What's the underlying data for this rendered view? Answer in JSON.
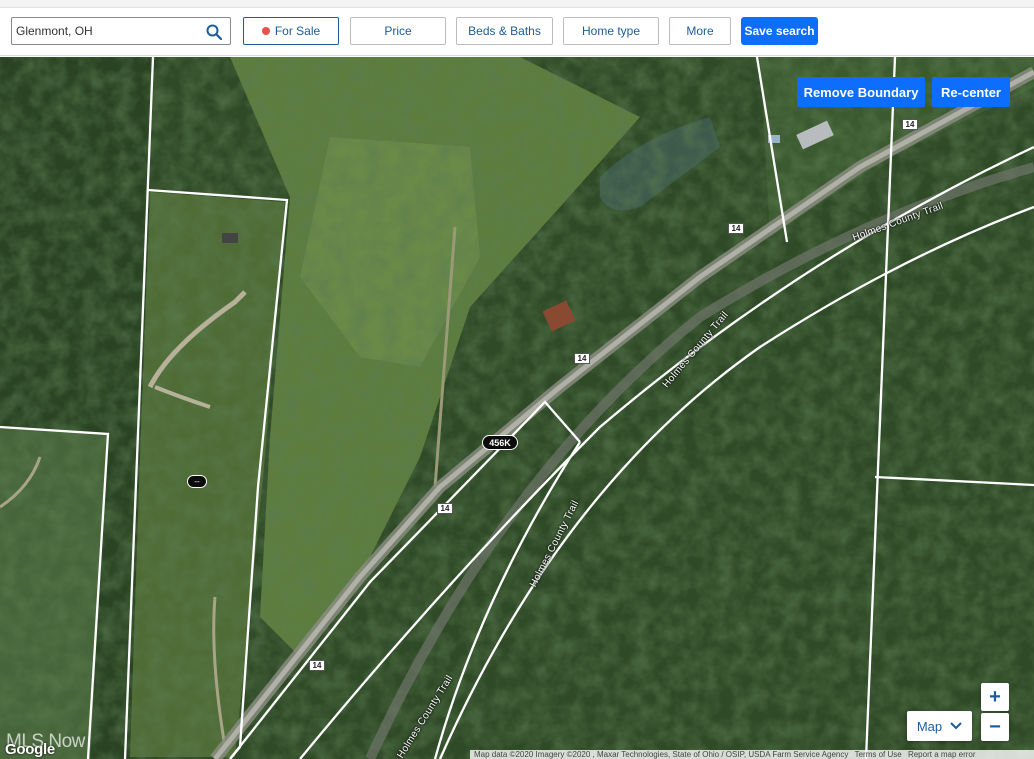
{
  "search": {
    "value": "Glenmont, OH"
  },
  "filters": {
    "for_sale": "For Sale",
    "price": "Price",
    "beds_baths": "Beds & Baths",
    "home_type": "Home type",
    "more": "More"
  },
  "save_search": "Save search",
  "map": {
    "remove_boundary": "Remove Boundary",
    "recenter": "Re-center",
    "road_labels": {
      "holmes_trail_top": "Holmes County Trail",
      "holmes_trail_mid": "Holmes County Trail",
      "holmes_trail_low": "Holmes County Trail",
      "holmes_trail_bottom": "Holmes County Trail"
    },
    "route_shields": [
      "14",
      "14",
      "14",
      "14",
      "14"
    ],
    "price_pin": "456K",
    "mini_pin": "--",
    "zoom_in": "+",
    "zoom_out": "−",
    "map_type": "Map",
    "attribution": {
      "data": "Map data ©2020 Imagery ©2020 , Maxar Technologies, State of Ohio / OSIP, USDA Farm Service Agency",
      "terms": "Terms of Use",
      "report": "Report a map error"
    },
    "google": "Google",
    "watermark": "MLS Now"
  },
  "colors": {
    "accent": "#0d6efd",
    "sale_dot": "#e8524b",
    "link_text": "#1c5c9c"
  },
  "icons": {
    "search": "search-icon",
    "chevron": "chevron-down-icon"
  }
}
